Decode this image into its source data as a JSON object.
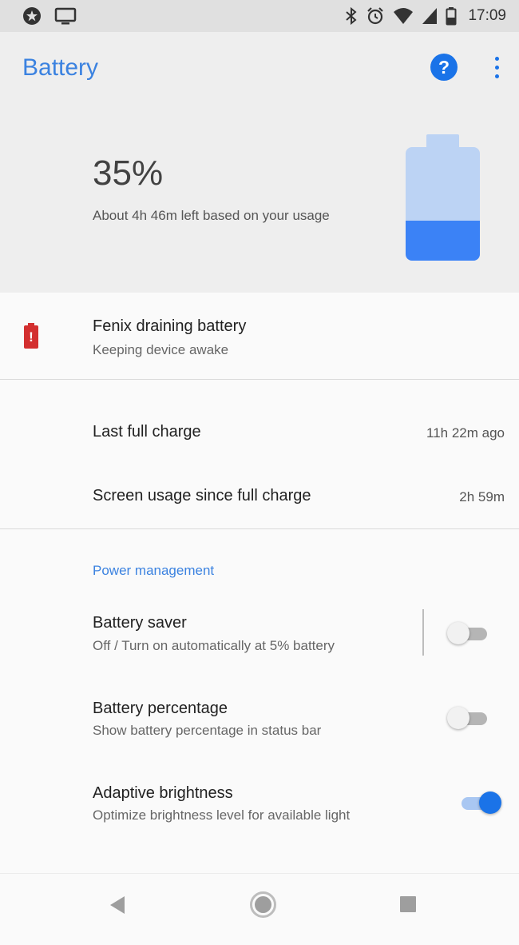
{
  "status_bar": {
    "time": "17:09",
    "icons": [
      "notification-icon",
      "cast-icon",
      "bluetooth-icon",
      "alarm-icon",
      "wifi-icon",
      "signal-icon",
      "battery-icon"
    ]
  },
  "app_bar": {
    "title": "Battery",
    "help_label": "?",
    "help_icon": "help-icon",
    "more_icon": "more-vert-icon"
  },
  "summary": {
    "percent": "35%",
    "level_fraction": 0.35,
    "estimate": "About 4h 46m left based on your usage"
  },
  "alert": {
    "title": "Fenix draining battery",
    "subtitle": "Keeping device awake",
    "icon": "battery-alert-icon",
    "icon_glyph": "!"
  },
  "usage": {
    "last_full_charge_label": "Last full charge",
    "last_full_charge_value": "11h 22m ago",
    "screen_usage_label": "Screen usage since full charge",
    "screen_usage_value": "2h 59m"
  },
  "power_management": {
    "header": "Power management",
    "items": [
      {
        "title": "Battery saver",
        "subtitle": "Off / Turn on automatically at 5% battery",
        "enabled": false
      },
      {
        "title": "Battery percentage",
        "subtitle": "Show battery percentage in status bar",
        "enabled": false
      },
      {
        "title": "Adaptive brightness",
        "subtitle": "Optimize brightness level for available light",
        "enabled": true
      }
    ]
  },
  "nav_bar": {
    "icons": [
      "back-icon",
      "home-icon",
      "recents-icon"
    ]
  },
  "colors": {
    "accent": "#1a73e8",
    "title_blue": "#3b82e0",
    "battery_fill": "#3b82f6",
    "battery_empty": "#bcd3f4",
    "alert_red": "#d32f2f"
  }
}
